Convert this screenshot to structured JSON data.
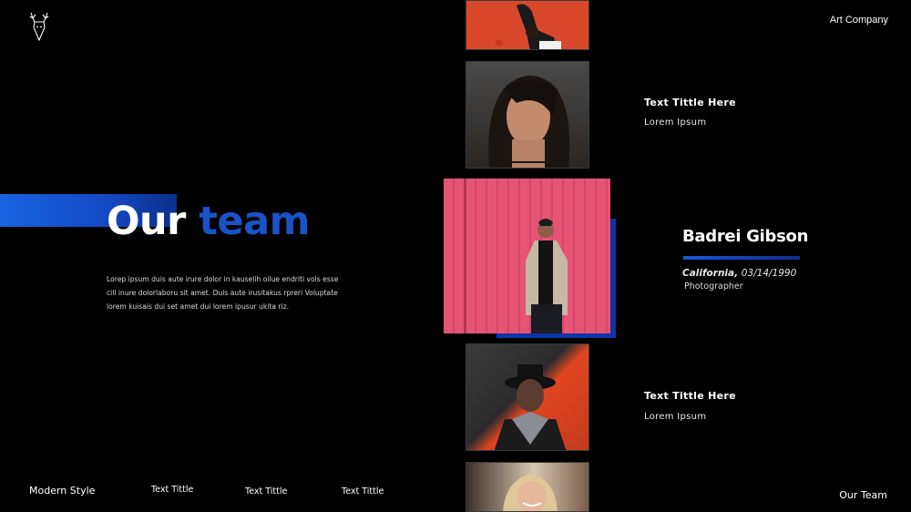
{
  "header": {
    "brand": "Art Company"
  },
  "hero": {
    "title_word1": "Our",
    "title_word2": "team",
    "description": "Lorep ipsum duis aute irure dolor in kauselih oilue endriti vols esse cill inure dolorlaboru sit amet. Duis aute irusitakus rpreri Voluptate lorem kuisais dui set amet dui lorem ipusur ukita riz."
  },
  "cards": [
    {
      "title": "Text Tittle Here",
      "subtitle": "Lorem Ipsum"
    },
    {
      "title": "Text Tittle Here",
      "subtitle": "Lorem Ipsum"
    }
  ],
  "featured": {
    "name": "Badrei Gibson",
    "location": "California,",
    "date": "03/14/1990",
    "role": "Photographer"
  },
  "footer": {
    "left": "Modern Style",
    "items": [
      "Text Tittle",
      "Text Tittle",
      "Text Tittle"
    ],
    "right": "Our Team"
  },
  "colors": {
    "accent": "#1a52c8",
    "background": "#000000"
  },
  "icons": {
    "logo": "deer-head-icon"
  }
}
